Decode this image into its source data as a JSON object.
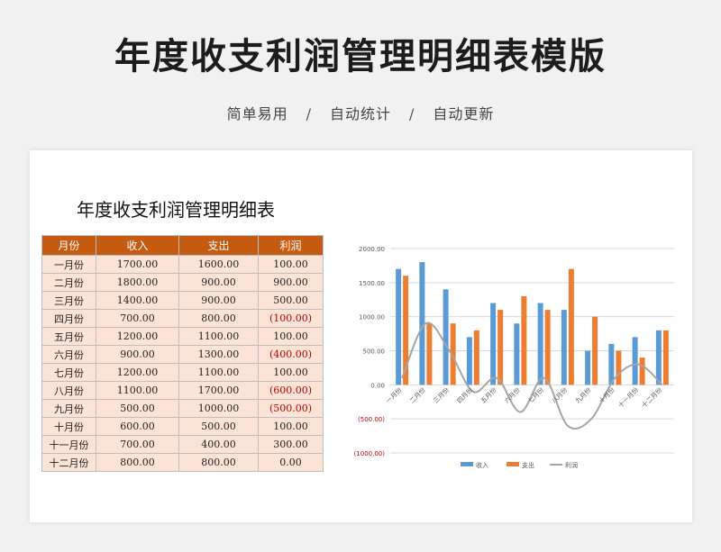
{
  "header": {
    "title": "年度收支利润管理明细表模版",
    "features": [
      "简单易用",
      "自动统计",
      "自动更新"
    ],
    "separator": "/"
  },
  "sheet": {
    "title": "年度收支利润管理明细表",
    "columns": [
      "月份",
      "收入",
      "支出",
      "利润"
    ],
    "rows": [
      {
        "month": "一月份",
        "income": "1700.00",
        "expense": "1600.00",
        "profit": "100.00",
        "negative": false
      },
      {
        "month": "二月份",
        "income": "1800.00",
        "expense": "900.00",
        "profit": "900.00",
        "negative": false
      },
      {
        "month": "三月份",
        "income": "1400.00",
        "expense": "900.00",
        "profit": "500.00",
        "negative": false
      },
      {
        "month": "四月份",
        "income": "700.00",
        "expense": "800.00",
        "profit": "(100.00)",
        "negative": true
      },
      {
        "month": "五月份",
        "income": "1200.00",
        "expense": "1100.00",
        "profit": "100.00",
        "negative": false
      },
      {
        "month": "六月份",
        "income": "900.00",
        "expense": "1300.00",
        "profit": "(400.00)",
        "negative": true
      },
      {
        "month": "七月份",
        "income": "1200.00",
        "expense": "1100.00",
        "profit": "100.00",
        "negative": false
      },
      {
        "month": "八月份",
        "income": "1100.00",
        "expense": "1700.00",
        "profit": "(600.00)",
        "negative": true
      },
      {
        "month": "九月份",
        "income": "500.00",
        "expense": "1000.00",
        "profit": "(500.00)",
        "negative": true
      },
      {
        "month": "十月份",
        "income": "600.00",
        "expense": "500.00",
        "profit": "100.00",
        "negative": false
      },
      {
        "month": "十一月份",
        "income": "700.00",
        "expense": "400.00",
        "profit": "300.00",
        "negative": false
      },
      {
        "month": "十二月份",
        "income": "800.00",
        "expense": "800.00",
        "profit": "0.00",
        "negative": false
      }
    ]
  },
  "colors": {
    "income": "#5b9bd5",
    "expense": "#ed7d31",
    "profit": "#a5a5a5",
    "header": "#c55a11",
    "row": "#fbe4d5",
    "negative": "#c00000"
  },
  "chart_data": {
    "type": "bar",
    "categories": [
      "一月份",
      "二月份",
      "三月份",
      "四月份",
      "五月份",
      "六月份",
      "七月份",
      "八月份",
      "九月份",
      "十月份",
      "十一月份",
      "十二月份"
    ],
    "series": [
      {
        "name": "收入",
        "type": "bar",
        "values": [
          1700,
          1800,
          1400,
          700,
          1200,
          900,
          1200,
          1100,
          500,
          600,
          700,
          800
        ]
      },
      {
        "name": "支出",
        "type": "bar",
        "values": [
          1600,
          900,
          900,
          800,
          1100,
          1300,
          1100,
          1700,
          1000,
          500,
          400,
          800
        ]
      },
      {
        "name": "利润",
        "type": "line",
        "smooth": true,
        "values": [
          100,
          900,
          500,
          -100,
          100,
          -400,
          100,
          -600,
          -500,
          100,
          300,
          0
        ]
      }
    ],
    "ylim": [
      -1000,
      2000
    ],
    "yticks": [
      2000,
      1500,
      1000,
      500,
      0,
      -500,
      -1000
    ],
    "ytick_labels": [
      "2000.00",
      "1500.00",
      "1000.00",
      "500.00",
      "0.00",
      "(500.00)",
      "(1000.00)"
    ],
    "grid": true,
    "legend": "bottom"
  }
}
